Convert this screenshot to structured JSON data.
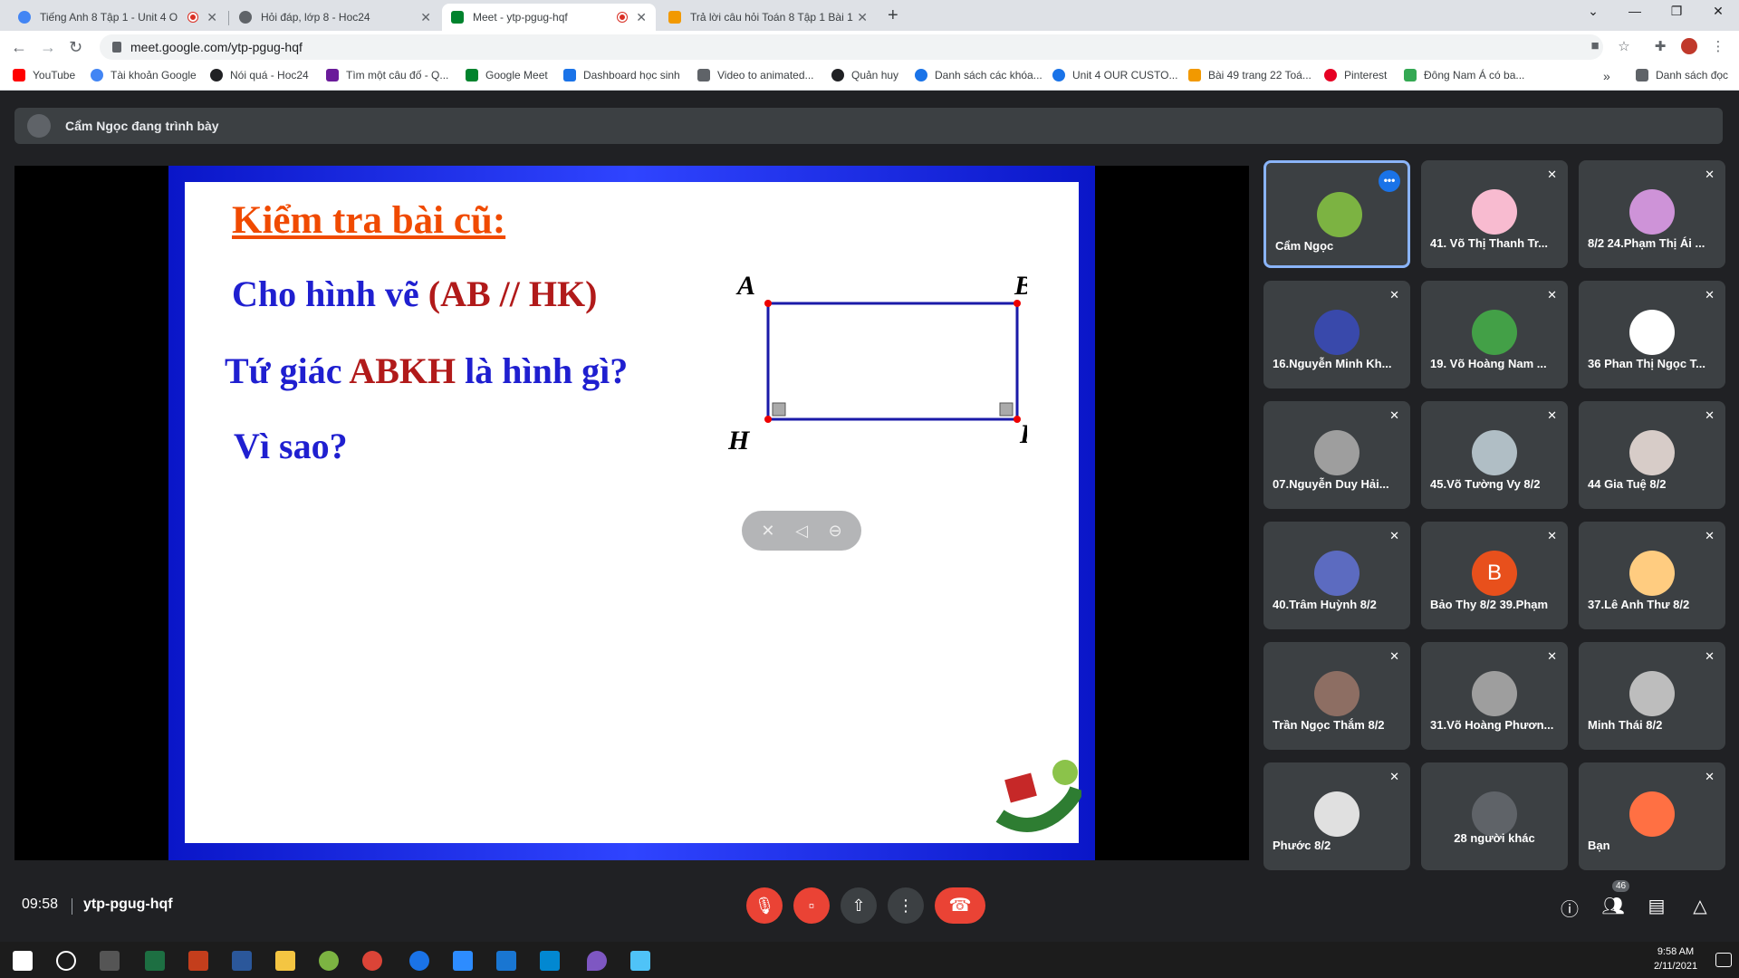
{
  "browser": {
    "tabs": [
      {
        "title": "Tiếng Anh 8 Tập 1 - Unit 4 O",
        "recording": true,
        "active": false,
        "icon_color": "#4285f4"
      },
      {
        "title": "Hỏi đáp, lớp 8 - Hoc24",
        "recording": false,
        "active": false,
        "icon_color": "#5f6368"
      },
      {
        "title": "Meet - ytp-pgug-hqf",
        "recording": true,
        "active": true,
        "icon_color": "#00832d"
      },
      {
        "title": "Trả lời câu hỏi Toán 8 Tập 1 Bài 1",
        "recording": false,
        "active": false,
        "icon_color": "#f29900"
      }
    ],
    "url": "meet.google.com/ytp-pgug-hqf",
    "bookmarks": [
      {
        "label": "YouTube",
        "color": "#ff0000"
      },
      {
        "label": "Tài khoản Google",
        "color": "#4285f4"
      },
      {
        "label": "Nói quá - Hoc24",
        "color": "#202124"
      },
      {
        "label": "Tìm một câu đố - Q...",
        "color": "#6a1b9a"
      },
      {
        "label": "Google Meet",
        "color": "#00832d"
      },
      {
        "label": "Dashboard học sinh",
        "color": "#1a73e8"
      },
      {
        "label": "Video to animated...",
        "color": "#5f6368"
      },
      {
        "label": "Quản huy",
        "color": "#202124"
      },
      {
        "label": "Danh sách các khóa...",
        "color": "#1a73e8"
      },
      {
        "label": "Unit 4 OUR CUSTO...",
        "color": "#1a73e8"
      },
      {
        "label": "Bài 49 trang 22 Toá...",
        "color": "#f29900"
      },
      {
        "label": "Pinterest",
        "color": "#e60023"
      },
      {
        "label": "Đông Nam Á có ba...",
        "color": "#34a853"
      }
    ],
    "reading_list": "Danh sách đọc",
    "overflow": "»"
  },
  "meet": {
    "presenter_text": "Cẩm Ngọc đang trình bày",
    "slide": {
      "title": "Kiểm tra bài cũ:",
      "line1_prefix": "Cho hình vẽ ",
      "line1_highlight": "(AB // HK)",
      "line2_prefix": "Tứ giác ",
      "line2_highlight": "ABKH",
      "line2_suffix": " là hình gì?",
      "line3": "Vì sao?",
      "labels": {
        "a": "A",
        "b": "B",
        "h": "H",
        "k": "K"
      }
    },
    "participants": [
      {
        "name": "Cẩm Ngọc",
        "color": "#7cb342",
        "active": true,
        "muted": false
      },
      {
        "name": "41. Võ Thị Thanh Tr...",
        "color": "#f8bbd0",
        "muted": true
      },
      {
        "name": "8/2 24.Phạm Thị Ái ...",
        "color": "#ce93d8",
        "muted": true
      },
      {
        "name": "16.Nguyễn Minh Kh...",
        "color": "#3949ab",
        "muted": true
      },
      {
        "name": "19. Võ Hoàng Nam ...",
        "color": "#43a047",
        "muted": true
      },
      {
        "name": "36 Phan Thị Ngọc T...",
        "color": "#ffffff",
        "muted": true
      },
      {
        "name": "07.Nguyễn Duy Hải...",
        "color": "#9e9e9e",
        "muted": true
      },
      {
        "name": "45.Võ Tường Vy 8/2",
        "color": "#b0bec5",
        "muted": true
      },
      {
        "name": "44 Gia Tuệ 8/2",
        "color": "#d7ccc8",
        "muted": true
      },
      {
        "name": "40.Trâm Huỳnh 8/2",
        "color": "#5c6bc0",
        "muted": true
      },
      {
        "name": "Bảo Thy 8/2 39.Phạm",
        "color": "#e8501c",
        "initial": "B",
        "muted": true
      },
      {
        "name": "37.Lê Anh Thư 8/2",
        "color": "#ffcc80",
        "muted": true
      },
      {
        "name": "Trần Ngọc Thắm 8/2",
        "color": "#8d6e63",
        "muted": true
      },
      {
        "name": "31.Võ Hoàng Phươn...",
        "color": "#9e9e9e",
        "muted": true
      },
      {
        "name": "Minh Thái 8/2",
        "color": "#bdbdbd",
        "muted": true
      },
      {
        "name": "Phước 8/2",
        "color": "#e0e0e0",
        "muted": true
      },
      {
        "name": "28 người khác",
        "color": "#5f6368",
        "muted": false,
        "others": true
      },
      {
        "name": "Bạn",
        "color": "#ff7043",
        "muted": true
      }
    ],
    "time": "09:58",
    "meeting_code": "ytp-pgug-hqf",
    "people_count": "46"
  },
  "taskbar": {
    "time": "9:58 AM",
    "date": "2/11/2021"
  }
}
